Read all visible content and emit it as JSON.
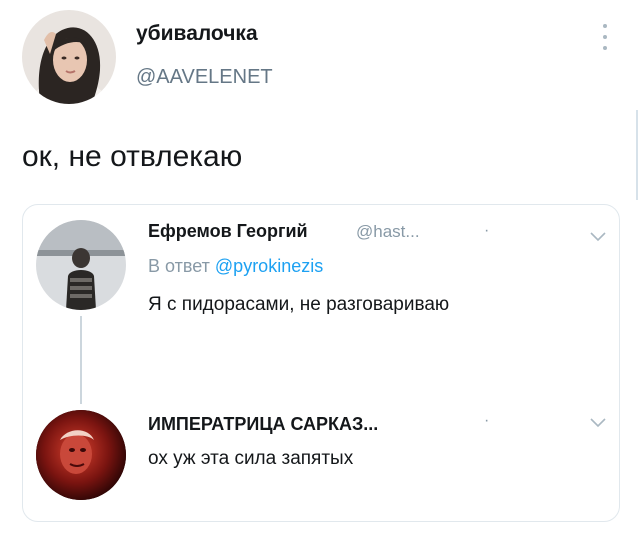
{
  "tweet": {
    "author_name": "убивалочка",
    "author_handle": "@AAVELENET",
    "text": "ок, не отвлекаю",
    "more_icon": "more-vertical-icon"
  },
  "quote": {
    "first": {
      "name": "Ефремов Георгий",
      "handle": "@hast...",
      "dot": "·",
      "reply_prefix": "В ответ",
      "reply_mention": "@pyrokinezis",
      "text": "Я с пидорасами, не разговариваю",
      "menu_icon": "chevron-down-icon"
    },
    "second": {
      "name": "ИМПЕРАТРИЦА САРКАЗ...",
      "dot": "·",
      "text": "ох уж эта сила запятых",
      "menu_icon": "chevron-down-icon"
    }
  },
  "colors": {
    "text": "#14171a",
    "secondary": "#657786",
    "link": "#1da1f2",
    "border": "#e1e8ed"
  }
}
